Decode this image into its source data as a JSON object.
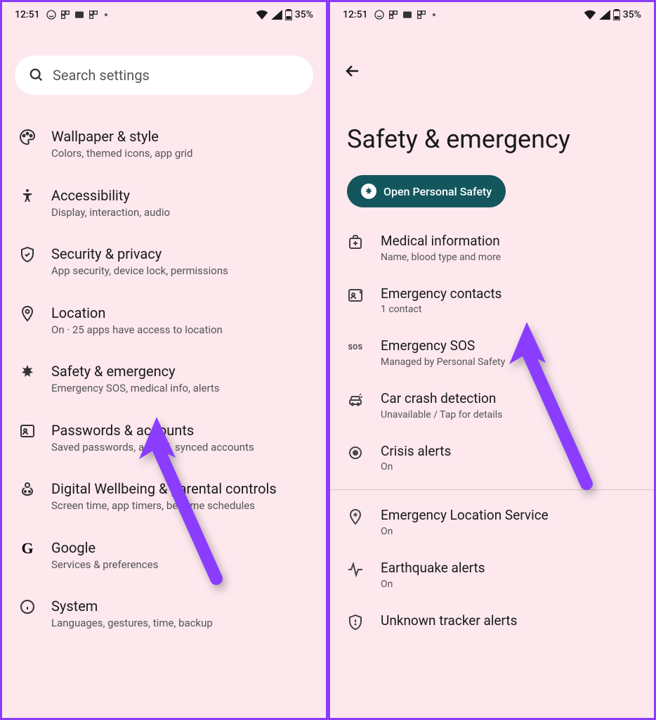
{
  "status": {
    "time": "12:51",
    "battery": "35%"
  },
  "left": {
    "search_placeholder": "Search settings",
    "items": [
      {
        "title": "Wallpaper & style",
        "subtitle": "Colors, themed icons, app grid"
      },
      {
        "title": "Accessibility",
        "subtitle": "Display, interaction, audio"
      },
      {
        "title": "Security & privacy",
        "subtitle": "App security, device lock, permissions"
      },
      {
        "title": "Location",
        "subtitle": "On · 25 apps have access to location"
      },
      {
        "title": "Safety & emergency",
        "subtitle": "Emergency SOS, medical info, alerts"
      },
      {
        "title": "Passwords & accounts",
        "subtitle": "Saved passwords, autofill, synced accounts"
      },
      {
        "title": "Digital Wellbeing & parental controls",
        "subtitle": "Screen time, app timers, bedtime schedules"
      },
      {
        "title": "Google",
        "subtitle": "Services & preferences"
      },
      {
        "title": "System",
        "subtitle": "Languages, gestures, time, backup"
      }
    ]
  },
  "right": {
    "page_title": "Safety & emergency",
    "chip_label": "Open Personal Safety",
    "items": [
      {
        "title": "Medical information",
        "subtitle": "Name, blood type and more"
      },
      {
        "title": "Emergency contacts",
        "subtitle": "1 contact"
      },
      {
        "title": "Emergency SOS",
        "subtitle": "Managed by Personal Safety"
      },
      {
        "title": "Car crash detection",
        "subtitle": "Unavailable / Tap for details"
      },
      {
        "title": "Crisis alerts",
        "subtitle": "On"
      }
    ],
    "items2": [
      {
        "title": "Emergency Location Service",
        "subtitle": "On"
      },
      {
        "title": "Earthquake alerts",
        "subtitle": "On"
      },
      {
        "title": "Unknown tracker alerts",
        "subtitle": ""
      }
    ]
  }
}
